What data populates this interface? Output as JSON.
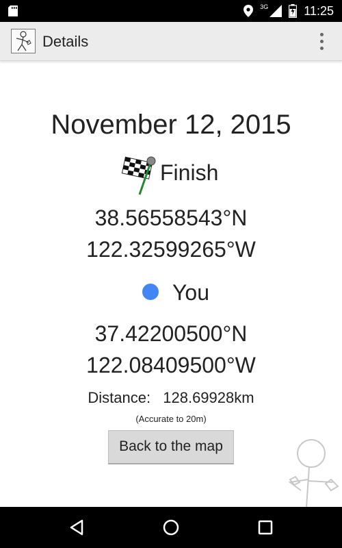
{
  "status_bar": {
    "time": "11:25",
    "network": "3G",
    "icons": [
      "sd-card-icon",
      "location-icon",
      "signal-icon",
      "battery-icon"
    ]
  },
  "action_bar": {
    "title": "Details",
    "icons": [
      "app-stick-figure-icon",
      "overflow-menu-icon"
    ]
  },
  "details": {
    "date": "November 12, 2015",
    "finish": {
      "label": "Finish",
      "latitude": "38.56558543°N",
      "longitude": "122.32599265°W",
      "icon": "checkered-flag-icon"
    },
    "you": {
      "label": "You",
      "latitude": "37.42200500°N",
      "longitude": "122.08409500°W",
      "dot_color": "#4385f4"
    },
    "distance_label": "Distance:",
    "distance_value": "128.69928km",
    "accuracy": "(Accurate to 20m)",
    "back_button": "Back to the map"
  },
  "nav_bar": {
    "icons": [
      "back-icon",
      "home-icon",
      "recents-icon"
    ]
  }
}
